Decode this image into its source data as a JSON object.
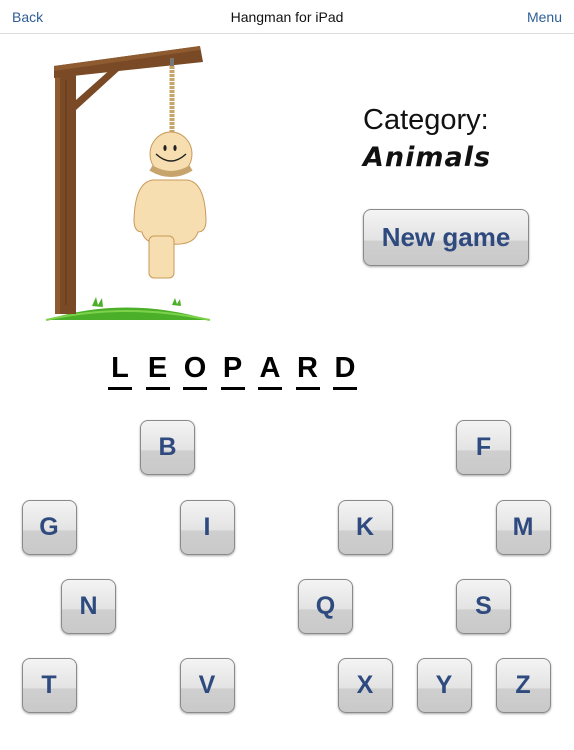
{
  "navbar": {
    "back_label": "Back",
    "title": "Hangman for iPad",
    "menu_label": "Menu"
  },
  "category": {
    "label": "Category:",
    "value": "Animals"
  },
  "new_game_label": "New game",
  "word": {
    "letters": [
      "L",
      "E",
      "O",
      "P",
      "A",
      "R",
      "D"
    ]
  },
  "keyboard": {
    "remaining_keys": [
      {
        "letter": "B",
        "row": 0,
        "col": 1
      },
      {
        "letter": "F",
        "row": 0,
        "col": 5
      },
      {
        "letter": "G",
        "row": 1,
        "col": 0
      },
      {
        "letter": "I",
        "row": 1,
        "col": 2
      },
      {
        "letter": "K",
        "row": 1,
        "col": 4
      },
      {
        "letter": "M",
        "row": 1,
        "col": 6
      },
      {
        "letter": "N",
        "row": 2,
        "col": 0
      },
      {
        "letter": "Q",
        "row": 2,
        "col": 3
      },
      {
        "letter": "S",
        "row": 2,
        "col": 5
      },
      {
        "letter": "T",
        "row": 3,
        "col": 0
      },
      {
        "letter": "V",
        "row": 3,
        "col": 2
      },
      {
        "letter": "X",
        "row": 3,
        "col": 4
      },
      {
        "letter": "Y",
        "row": 3,
        "col": 5
      },
      {
        "letter": "Z",
        "row": 3,
        "col": 6
      }
    ]
  },
  "colors": {
    "link": "#2f5e96",
    "key_text": "#2e4a7e",
    "wood": "#7a4a26",
    "grass": "#4caf2a",
    "figure": "#f7deb0"
  }
}
